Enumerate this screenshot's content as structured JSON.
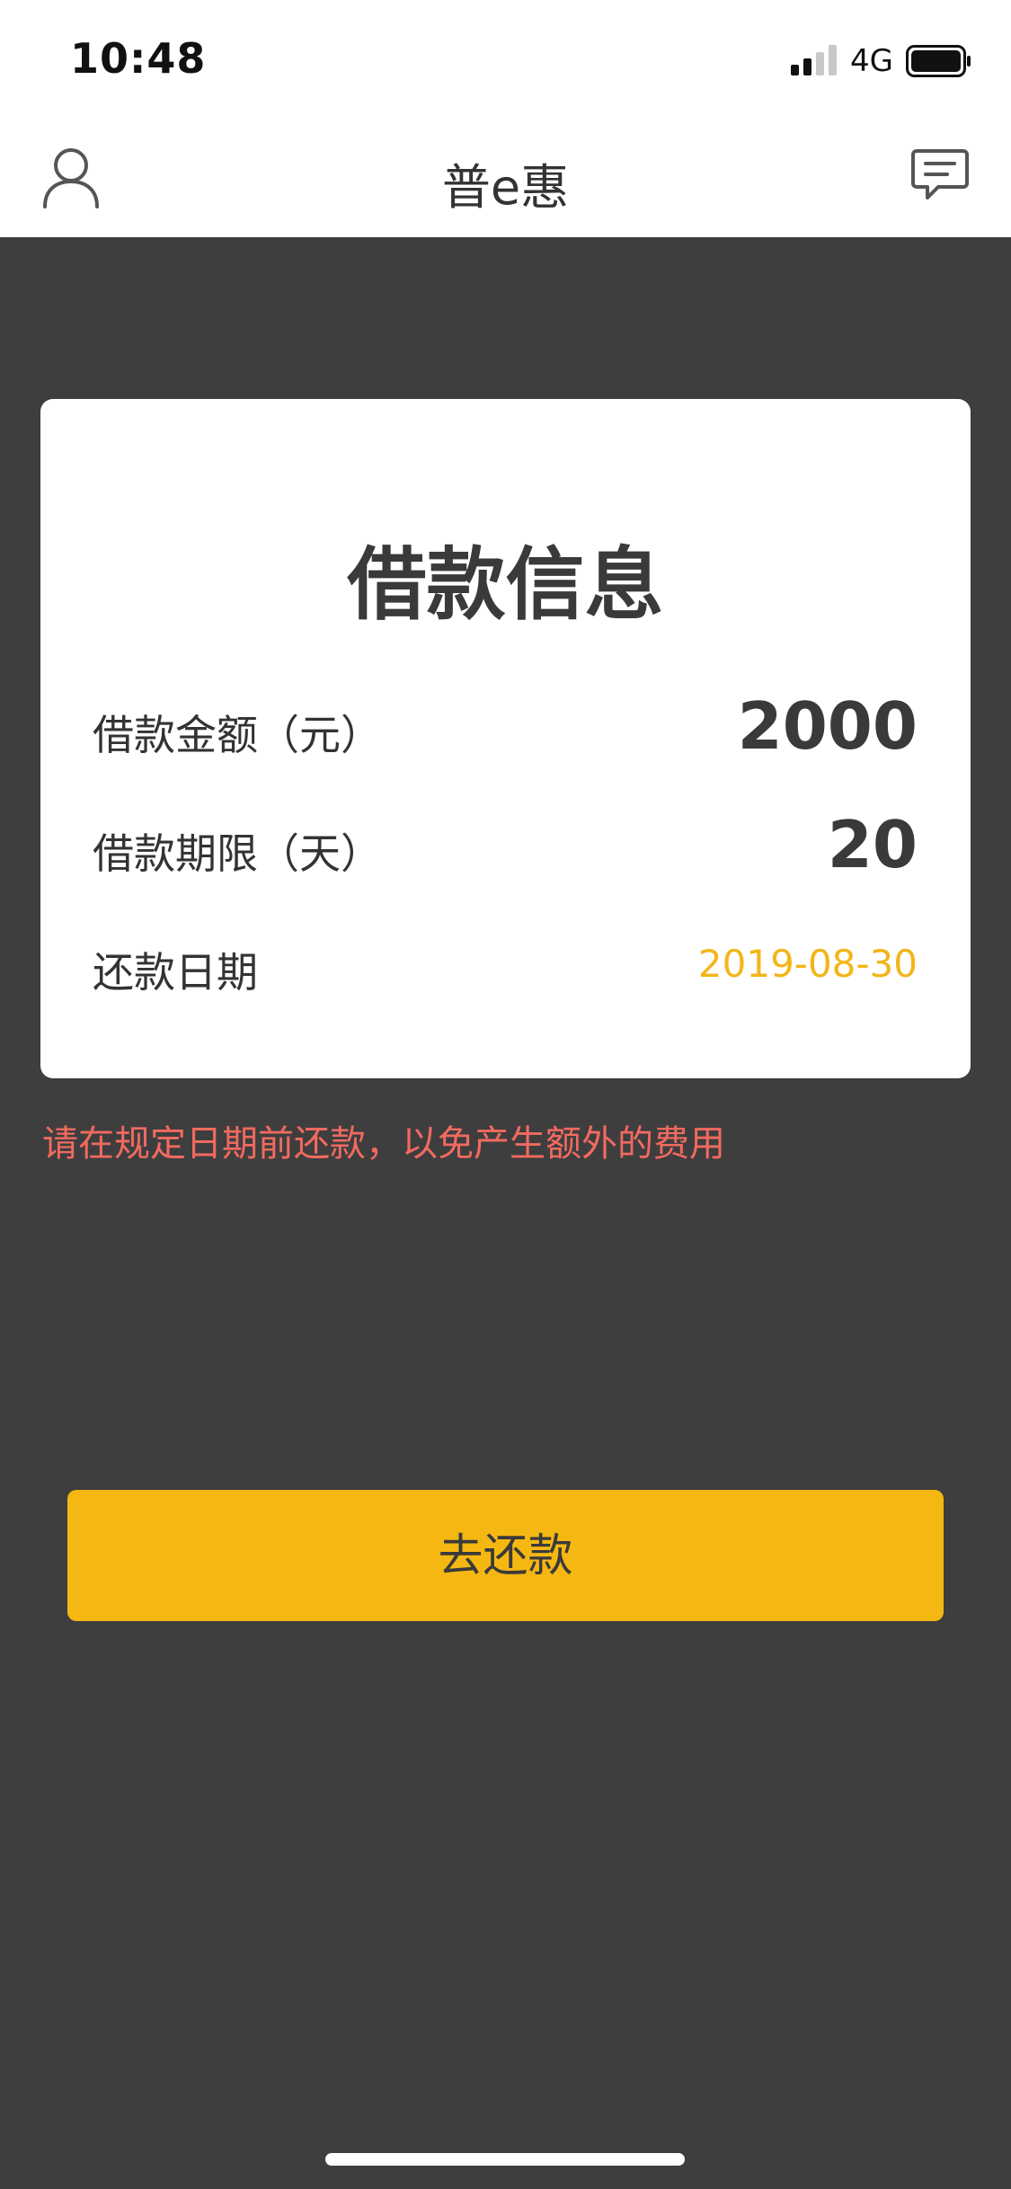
{
  "status_bar": {
    "time": "10:48",
    "network": "4G"
  },
  "nav": {
    "title": "普e惠",
    "profile_icon": "user-icon",
    "message_icon": "chat-icon"
  },
  "card": {
    "title": "借款信息",
    "rows": [
      {
        "label": "借款金额（元）",
        "value": "2000"
      },
      {
        "label": "借款期限（天）",
        "value": "20"
      },
      {
        "label": "还款日期",
        "value": "2019-08-30"
      }
    ]
  },
  "notice": "请在规定日期前还款，以免产生额外的费用",
  "repay_button": {
    "label": "去还款"
  },
  "colors": {
    "accent": "#f5b711",
    "date": "#f2b619",
    "warning": "#f26a5f",
    "background": "#3e3e3f"
  }
}
